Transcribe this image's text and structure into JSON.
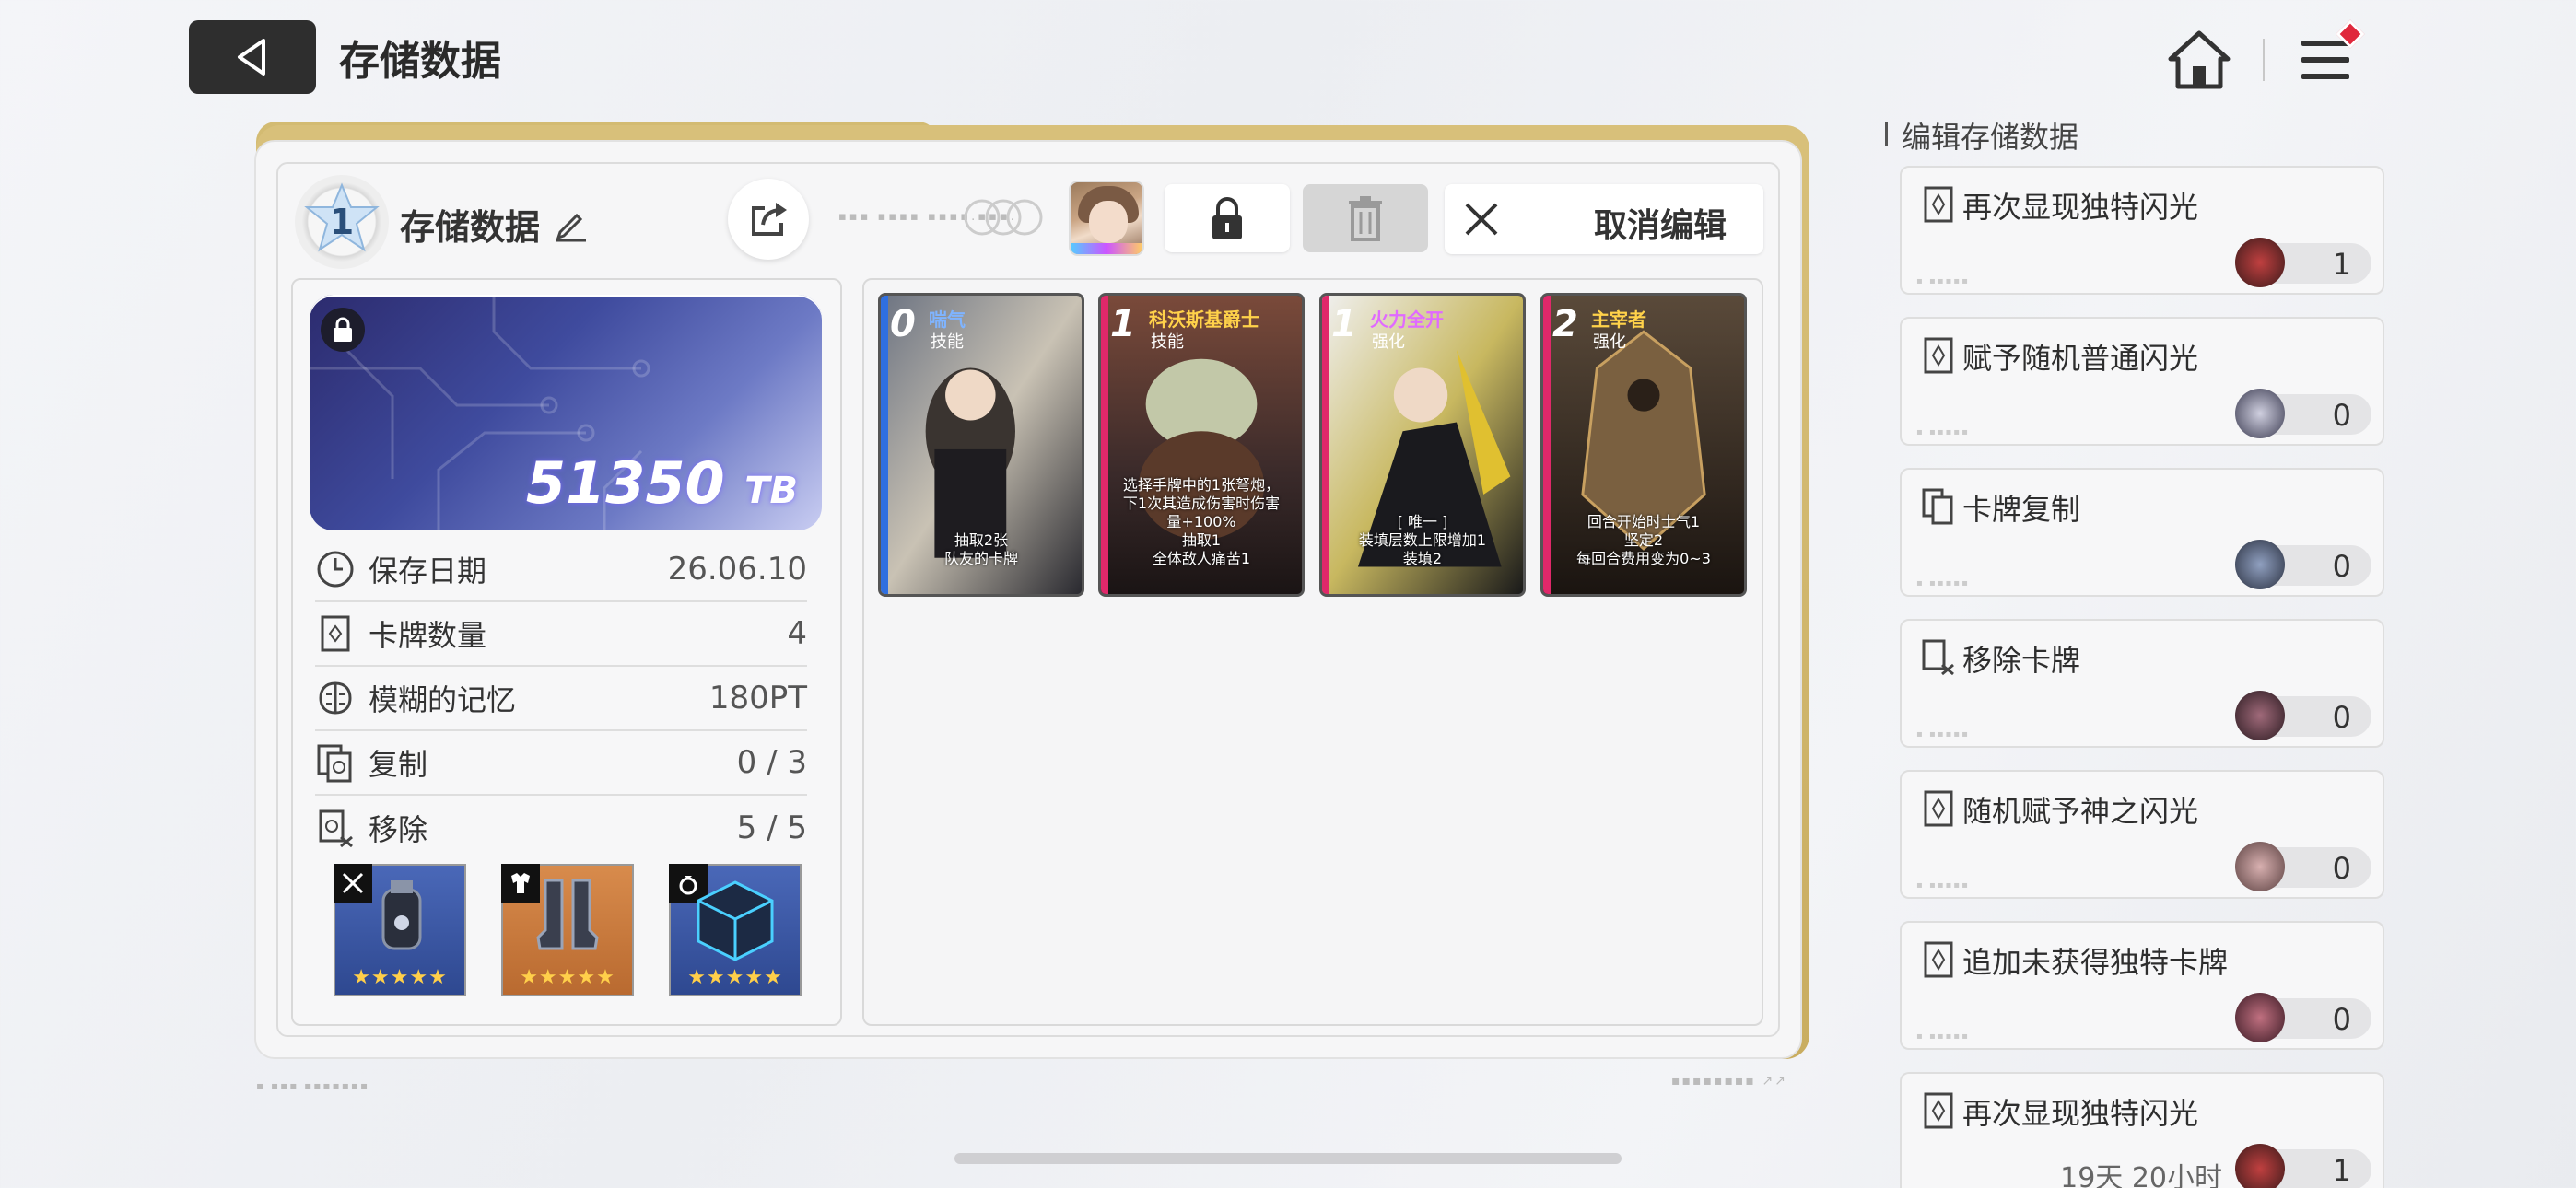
{
  "header": {
    "title": "存储数据",
    "back_icon": "back-arrow-icon",
    "home_icon": "home-icon",
    "menu_icon": "menu-icon"
  },
  "slot": {
    "number": "1",
    "title": "存储数据",
    "cancel_label": "取消编辑"
  },
  "tb_card": {
    "value": "51350",
    "unit": "TB"
  },
  "stats": [
    {
      "icon": "clock-icon",
      "name": "保存日期",
      "value": "26.06.10"
    },
    {
      "icon": "card-count-icon",
      "name": "卡牌数量",
      "value": "4"
    },
    {
      "icon": "brain-icon",
      "name": "模糊的记忆",
      "value": "180PT"
    },
    {
      "icon": "copy-card-icon",
      "name": "复制",
      "value": "0 / 3"
    },
    {
      "icon": "remove-card-icon",
      "name": "移除",
      "value": "5 / 5"
    }
  ],
  "equipment": [
    {
      "slot": "weapon",
      "stars": "★★★★★",
      "color": "#3e5aa8"
    },
    {
      "slot": "armor",
      "stars": "★★★★★",
      "color": "#c8773a"
    },
    {
      "slot": "ring",
      "stars": "★★★★★",
      "color": "#3e5aa8"
    }
  ],
  "cards": [
    {
      "cost": "0",
      "name": "喘气",
      "type": "技能",
      "desc": "抽取2张\n队友的卡牌",
      "accent": "#2f6fe0",
      "name_color": "#7fb4ff"
    },
    {
      "cost": "1",
      "name": "科沃斯基爵士",
      "type": "技能",
      "desc": "选择手牌中的1张弩炮，\n下1次其造成伤害时伤害\n量+100%\n抽取1\n全体敌人痛苦1",
      "accent": "#e0286a",
      "name_color": "#ffd24a"
    },
    {
      "cost": "1",
      "name": "火力全开",
      "type": "强化",
      "desc": "[ 唯一 ]\n装填层数上限增加1\n装填2",
      "accent": "#e0286a",
      "name_color": "#e06aff"
    },
    {
      "cost": "2",
      "name": "主宰者",
      "type": "强化",
      "desc": "回合开始时士气1\n坚定2\n每回合费用变为0~3",
      "accent": "#e0286a",
      "name_color": "#ffd24a"
    }
  ],
  "right_panel": {
    "title": "编辑存储数据",
    "items": [
      {
        "name": "再次显现独特闪光",
        "count": "1",
        "icon": "flash-icon",
        "ava_color": "#8a2a2a"
      },
      {
        "name": "赋予随机普通闪光",
        "count": "0",
        "icon": "flash-icon",
        "ava_color": "#6a6a80"
      },
      {
        "name": "卡牌复制",
        "count": "0",
        "icon": "copy-card-icon",
        "ava_color": "#5a6a8a"
      },
      {
        "name": "移除卡牌",
        "count": "0",
        "icon": "remove-card-icon",
        "ava_color": "#6a4a50"
      },
      {
        "name": "随机赋予神之闪光",
        "count": "0",
        "icon": "flash-icon",
        "ava_color": "#8a7070"
      },
      {
        "name": "追加未获得独特卡牌",
        "count": "0",
        "icon": "flash-icon",
        "ava_color": "#7a4a55"
      },
      {
        "name": "再次显现独特闪光",
        "count": "1",
        "icon": "flash-icon",
        "ava_color": "#8a2a2a",
        "timer": "19天 20小时"
      }
    ]
  }
}
